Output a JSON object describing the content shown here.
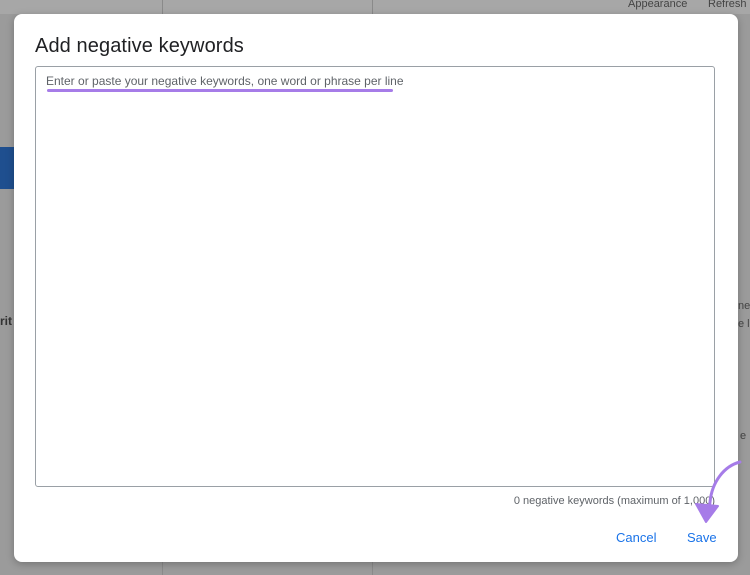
{
  "background": {
    "tab_appearance": "Appearance",
    "tab_refresh": "Refresh",
    "left_fragment": "rit",
    "right_fragment_1": "ned",
    "right_fragment_2": "e l",
    "right_fragment_3": "e"
  },
  "dialog": {
    "title": "Add negative keywords",
    "textarea": {
      "value": "",
      "placeholder": "Enter or paste your negative keywords, one word or phrase per line"
    },
    "keyword_count": "0 negative keywords (maximum of 1,000)",
    "cancel_label": "Cancel",
    "save_label": "Save"
  },
  "colors": {
    "accent": "#1a73e8",
    "annotation": "#a67ce8",
    "title": "#202124"
  },
  "icons": {
    "annotation_arrow": "curved-arrow-icon"
  }
}
